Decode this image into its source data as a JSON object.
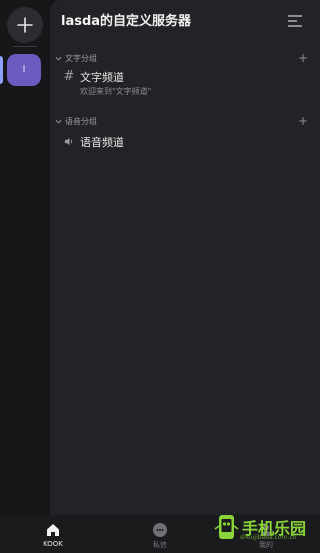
{
  "server": {
    "name": "lasda的自定义服务器",
    "icon_letter": "l"
  },
  "categories": [
    {
      "label": "文字分组",
      "channels": [
        {
          "name": "文字频道",
          "description": "欢迎来到\"文字频道\"",
          "icon": "hash-icon"
        }
      ]
    },
    {
      "label": "语音分组",
      "channels": [
        {
          "name": "语音频道",
          "icon": "speaker-icon"
        }
      ]
    }
  ],
  "bottom_nav": [
    {
      "label": "KOOK",
      "icon": "home-icon",
      "active": true
    },
    {
      "label": "私信",
      "icon": "chat-bubble-icon",
      "active": false
    },
    {
      "label": "我的",
      "icon": "profile-icon",
      "active": false
    }
  ],
  "watermark": {
    "text": "手机乐园",
    "url": "shoujibaba.com.cn"
  },
  "colors": {
    "accent": "#6a5bbf",
    "panel": "#222326",
    "rail": "#161719",
    "watermark": "#8ad339"
  }
}
